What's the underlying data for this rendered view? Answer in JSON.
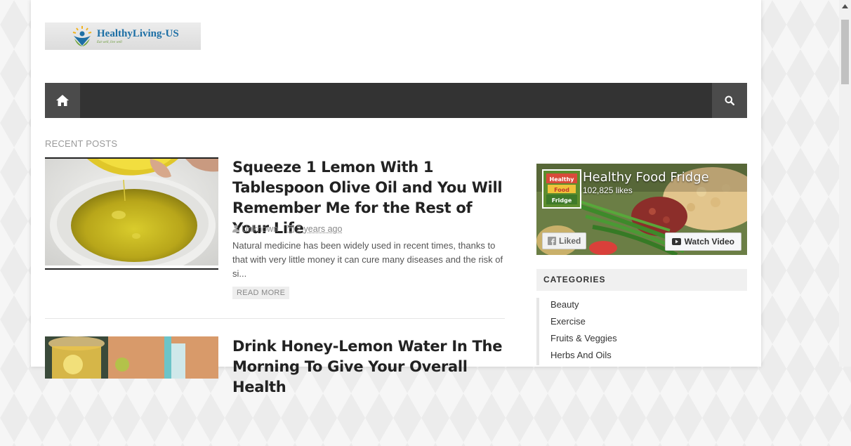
{
  "logo": {
    "text": "HealthyLiving-US",
    "tagline": "Eat well, live well"
  },
  "nav": {
    "home_icon": "home-icon",
    "search_icon": "search-icon"
  },
  "main": {
    "section_label": "RECENT POSTS",
    "posts": [
      {
        "title": "Squeeze 1 Lemon With 1 Tablespoon Olive Oil and You Will Remember Me for the Rest of Your Life",
        "author": "Unknown",
        "time": "2 years ago",
        "excerpt": "Natural medicine has been widely used in recent times, thanks to that with very little money it can cure many diseases and the risk of si...",
        "read_more": "READ MORE"
      },
      {
        "title": "Drink Honey-Lemon Water In The Morning To Give Your Overall Health"
      }
    ]
  },
  "sidebar": {
    "facebook": {
      "page_name": "Healthy Food Fridge",
      "likes": "102,825 likes",
      "liked_label": "Liked",
      "watch_label": "Watch Video",
      "thumb_text": "Healthy Food Fridge"
    },
    "categories": {
      "title": "CATEGORIES",
      "items": [
        "Beauty",
        "Exercise",
        "Fruits & Veggies",
        "Herbs And Oils"
      ]
    }
  },
  "colors": {
    "navbar": "#333333",
    "nav_button": "#4b4b4b",
    "title_text": "#222222",
    "meta_text": "#888888"
  }
}
